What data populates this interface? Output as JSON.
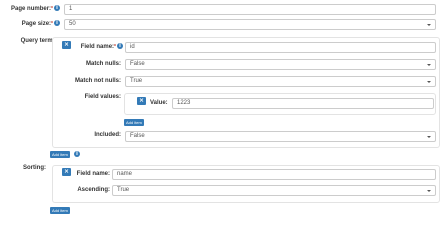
{
  "page_number": {
    "label": "Page number:",
    "required_mark": "*",
    "value": "1"
  },
  "page_size": {
    "label": "Page size:",
    "required_mark": "*",
    "selected": "50"
  },
  "query_terms": {
    "label": "Query terms:",
    "remove_icon": "x-icon",
    "field_name": {
      "label": "Field name:",
      "required_mark": "*",
      "value": "id"
    },
    "match_nulls": {
      "label": "Match nulls:",
      "selected": "False"
    },
    "match_not_nulls": {
      "label": "Match not nulls:",
      "selected": "True"
    },
    "field_values": {
      "label": "Field values:",
      "value": {
        "label": "Value:",
        "value": "1223"
      },
      "add_label": "Add item"
    },
    "included": {
      "label": "Included:",
      "selected": "False"
    },
    "add_label": "Add item"
  },
  "sorting": {
    "label": "Sorting:",
    "field_name": {
      "label": "Field name:",
      "value": "name"
    },
    "ascending": {
      "label": "Ascending:",
      "selected": "True"
    },
    "add_label": "Add item"
  },
  "colors": {
    "accent": "#337ab7",
    "border": "#cccccc",
    "required": "#c0392b"
  }
}
